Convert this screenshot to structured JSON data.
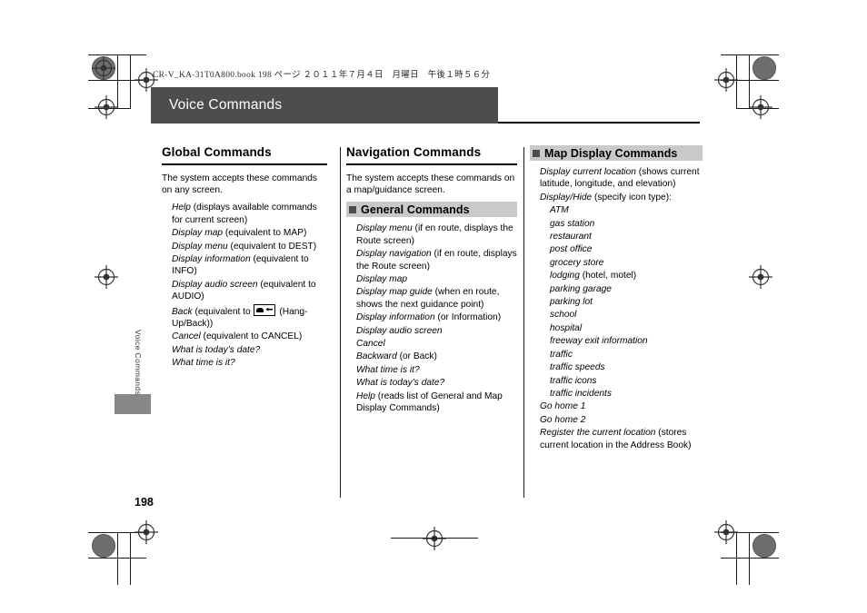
{
  "print_header": {
    "file_line": "CR-V_KA-31T0A800.book   198 ページ   ２０１１年７月４日　月曜日　午後１時５６分"
  },
  "chapter": {
    "title": "Voice Commands",
    "running_head": "Voice Commands",
    "page_number": "198"
  },
  "columns": {
    "global": {
      "heading": "Global Commands",
      "intro": "The system accepts these commands on any screen.",
      "items": [
        {
          "cmd": "Help",
          "note": " (displays available commands for current screen)"
        },
        {
          "cmd": "Display map",
          "note": " (equivalent to MAP)"
        },
        {
          "cmd": "Display menu",
          "note": " (equivalent to DEST)"
        },
        {
          "cmd": "Display information",
          "note": " (equivalent to INFO)"
        },
        {
          "cmd": "Display audio screen",
          "note": " (equivalent to AUDIO)"
        },
        {
          "cmd": "Back",
          "note": " (equivalent to ",
          "glyph": "hangup-back-key-icon",
          "note2": " (Hang-Up/Back))"
        },
        {
          "cmd": "Cancel",
          "note": " (equivalent to CANCEL)"
        },
        {
          "cmd": "What is today’s date?",
          "note": ""
        },
        {
          "cmd": "What time is it?",
          "note": ""
        }
      ]
    },
    "navigation": {
      "heading": "Navigation Commands",
      "intro": "The system accepts these commands on a map/guidance screen.",
      "subheading": "General Commands",
      "items": [
        {
          "cmd": "Display menu",
          "note": " (if en route, displays the Route screen)"
        },
        {
          "cmd": "Display navigation",
          "note": " (if en route, displays the Route screen)"
        },
        {
          "cmd": "Display map",
          "note": ""
        },
        {
          "cmd": "Display map guide",
          "note": " (when en route, shows the next guidance point)"
        },
        {
          "cmd": "Display information",
          "note": " (or Information)"
        },
        {
          "cmd": "Display audio screen",
          "note": ""
        },
        {
          "cmd": "Cancel",
          "note": ""
        },
        {
          "cmd": "Backward",
          "note": " (or Back)"
        },
        {
          "cmd": "What time is it?",
          "note": ""
        },
        {
          "cmd": "What is today’s date?",
          "note": ""
        },
        {
          "cmd": "Help",
          "note": " (reads list of General and Map Display Commands)"
        }
      ]
    },
    "map_display": {
      "subheading": "Map Display Commands",
      "items": [
        {
          "cmd": "Display current location",
          "note": " (shows current latitude, longitude, and elevation)",
          "level": 1
        },
        {
          "cmd": "Display/Hide",
          "note": " (specify icon type):",
          "level": 1
        },
        {
          "cmd": "ATM",
          "note": "",
          "level": 2
        },
        {
          "cmd": "gas station",
          "note": "",
          "level": 2
        },
        {
          "cmd": "restaurant",
          "note": "",
          "level": 2
        },
        {
          "cmd": "post office",
          "note": "",
          "level": 2
        },
        {
          "cmd": "grocery store",
          "note": "",
          "level": 2
        },
        {
          "cmd": "lodging",
          "note": " (hotel, motel)",
          "level": 2
        },
        {
          "cmd": "parking garage",
          "note": "",
          "level": 2
        },
        {
          "cmd": "parking lot",
          "note": "",
          "level": 2
        },
        {
          "cmd": "school",
          "note": "",
          "level": 2
        },
        {
          "cmd": "hospital",
          "note": "",
          "level": 2
        },
        {
          "cmd": "freeway exit information",
          "note": "",
          "level": 2
        },
        {
          "cmd": "traffic",
          "note": "",
          "level": 2
        },
        {
          "cmd": "traffic speeds",
          "note": "",
          "level": 2
        },
        {
          "cmd": "traffic icons",
          "note": "",
          "level": 2
        },
        {
          "cmd": "traffic incidents",
          "note": "",
          "level": 2
        },
        {
          "cmd": "Go home 1",
          "note": "",
          "level": 1
        },
        {
          "cmd": "Go home 2",
          "note": "",
          "level": 1
        },
        {
          "cmd": "Register the current location",
          "note": " (stores current location in the Address Book)",
          "level": 1
        }
      ]
    }
  },
  "colors": {
    "title_bar": "#4d4d4d",
    "band": "#c9c9c9",
    "band_square": "#4d4d4d",
    "side_tab": "#878787",
    "reg_dot": "#6e6e6e"
  }
}
